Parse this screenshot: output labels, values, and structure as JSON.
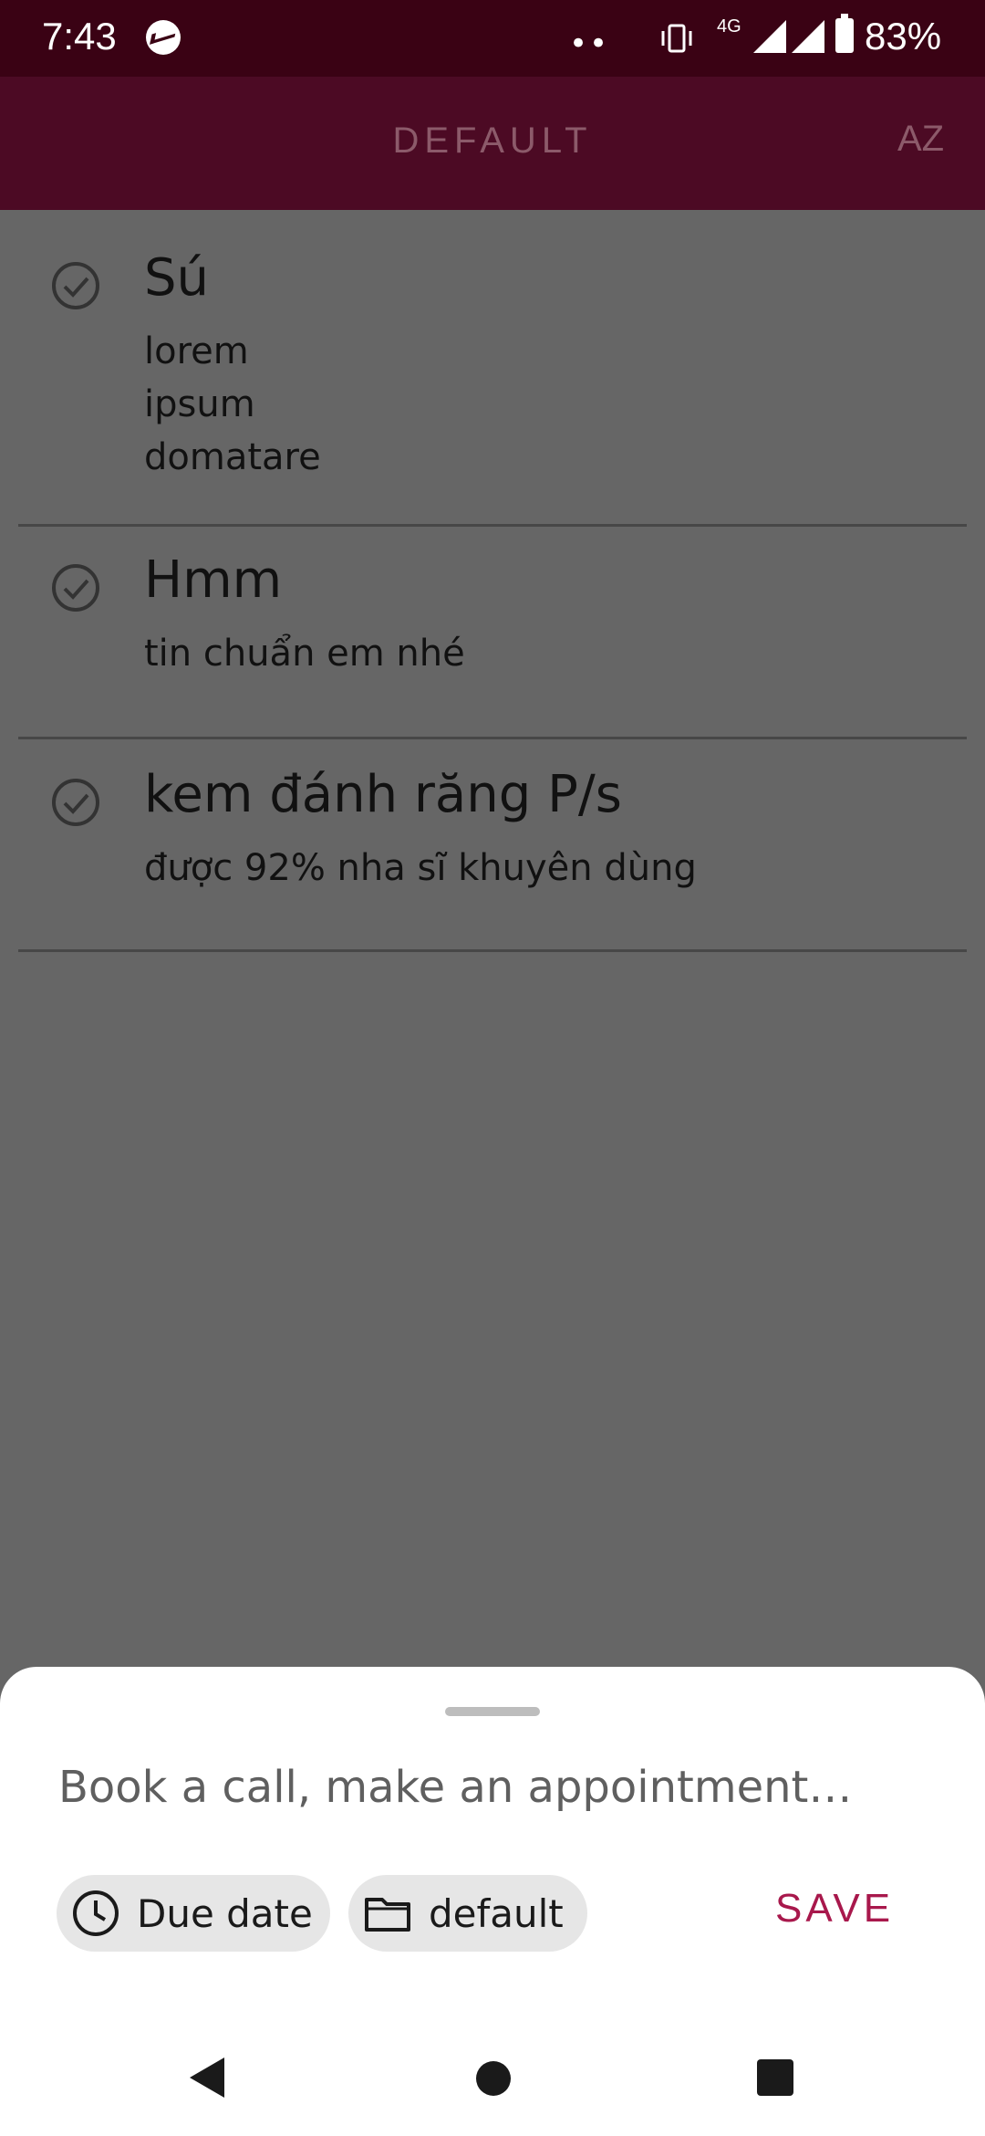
{
  "status_bar": {
    "time": "7:43",
    "dots": "••",
    "network": "4G",
    "battery_percent": "83%",
    "icons": [
      "messenger-icon",
      "vibrate-icon",
      "signal-icon",
      "battery-icon"
    ]
  },
  "app_bar": {
    "title": "DEFAULT",
    "sort_icon_label": "AZ"
  },
  "tasks": [
    {
      "title": "Sú",
      "notes": "lorem\nipsum\ndomatare"
    },
    {
      "title": "Hmm",
      "notes": "tin chuẩn em nhé"
    },
    {
      "title": "kem đánh răng P/s",
      "notes": "được 92% nha sĩ khuyên dùng"
    }
  ],
  "new_task_sheet": {
    "placeholder": "Book a call, make an appointment…",
    "due_date_label": "Due date",
    "list_label": "default",
    "save_label": "SAVE"
  },
  "colors": {
    "status_bar": "#3a0214",
    "app_bar": "#4c0a24",
    "accent": "#a8184c",
    "scrim": "#666666",
    "chip": "#e6e6e6"
  }
}
